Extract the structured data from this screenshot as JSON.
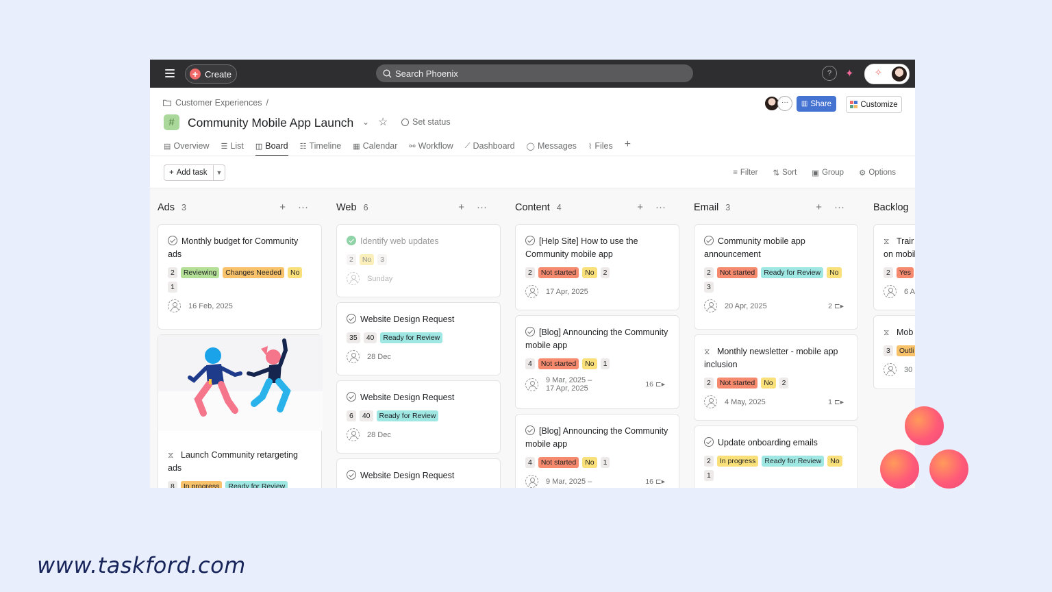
{
  "topbar": {
    "create_label": "Create",
    "search_placeholder": "Search Phoenix",
    "help_label": "?"
  },
  "header": {
    "breadcrumb": "Customer Experiences",
    "breadcrumb_sep": "/",
    "title": "Community Mobile App Launch",
    "set_status": "Set status",
    "share_label": "Share",
    "customize_label": "Customize"
  },
  "tabs": [
    "Overview",
    "List",
    "Board",
    "Timeline",
    "Calendar",
    "Workflow",
    "Dashboard",
    "Messages",
    "Files"
  ],
  "active_tab": "Board",
  "toolbar": {
    "add_task": "Add task",
    "filter": "Filter",
    "sort": "Sort",
    "group": "Group",
    "options": "Options"
  },
  "columns": [
    {
      "name": "Ads",
      "count": "3",
      "cards": [
        {
          "title": "Monthly budget for Community ads",
          "tags": [
            "2",
            "Reviewing",
            "Changes Needed",
            "No",
            "1"
          ],
          "date": "16 Feb, 2025"
        },
        {
          "title": "Launch Community retargeting ads",
          "tags": [
            "8",
            "In progress",
            "Ready for Review"
          ]
        }
      ]
    },
    {
      "name": "Web",
      "count": "6",
      "cards": [
        {
          "title": "Identify web updates",
          "tags": [
            "2",
            "No",
            "3"
          ],
          "date": "Sunday"
        },
        {
          "title": "Website Design Request",
          "tags": [
            "35",
            "40",
            "Ready for Review"
          ],
          "date": "28 Dec"
        },
        {
          "title": "Website Design Request",
          "tags": [
            "6",
            "40",
            "Ready for Review"
          ],
          "date": "28 Dec"
        },
        {
          "title": "Website Design Request"
        }
      ]
    },
    {
      "name": "Content",
      "count": "4",
      "cards": [
        {
          "title": "[Help Site] How to use the Community mobile app",
          "tags": [
            "2",
            "Not started",
            "No",
            "2"
          ],
          "date": "17 Apr, 2025"
        },
        {
          "title": "[Blog] Announcing the Community mobile app",
          "tags": [
            "4",
            "Not started",
            "No",
            "1"
          ],
          "date_start": "9 Mar, 2025 –",
          "date_end": "17 Apr, 2025",
          "subtasks": "16"
        },
        {
          "title": "[Blog] Announcing the Community mobile app",
          "tags": [
            "4",
            "Not started",
            "No",
            "1"
          ],
          "date_start": "9 Mar, 2025 –",
          "subtasks": "16"
        }
      ]
    },
    {
      "name": "Email",
      "count": "3",
      "cards": [
        {
          "title": "Community mobile app announcement",
          "tags": [
            "2",
            "Not started",
            "Ready for Review",
            "No",
            "3"
          ],
          "date": "20 Apr, 2025",
          "subtasks": "2"
        },
        {
          "title": "Monthly newsletter - mobile app inclusion",
          "tags": [
            "2",
            "Not started",
            "No",
            "2"
          ],
          "date": "4 May, 2025",
          "subtasks": "1"
        },
        {
          "title": "Update onboarding emails",
          "tags": [
            "2",
            "In progress",
            "Ready for Review",
            "No",
            "1"
          ]
        }
      ]
    },
    {
      "name": "Backlog",
      "cards": [
        {
          "title_line1": "Trair",
          "title_line2": "on mobil",
          "tags": [
            "2",
            "Yes"
          ],
          "date": "6 A"
        },
        {
          "title": "Mob",
          "tags": [
            "3",
            "Outli"
          ],
          "date": "30"
        }
      ]
    }
  ],
  "footer": {
    "url": "www.taskford.com"
  },
  "colors": {
    "topbar": "#2e2e30",
    "share": "#4573d2",
    "tag_green": "#b3df97",
    "tag_orange": "#f8c26a",
    "tag_yellow": "#f9e07a",
    "tag_red": "#f58a6e",
    "tag_teal": "#9ee7e3",
    "footer_text": "#17245a"
  }
}
